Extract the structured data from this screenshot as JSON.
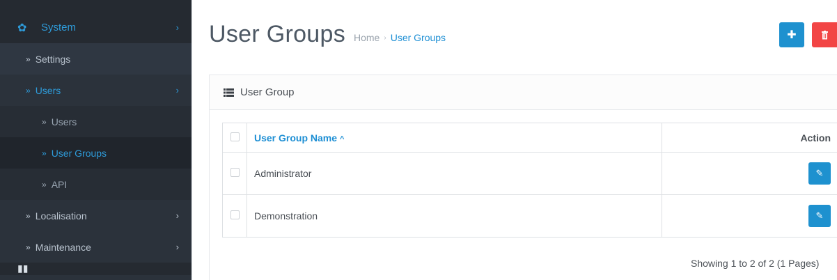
{
  "sidebar": {
    "system": "System",
    "settings": "Settings",
    "users_group": "Users",
    "users": "Users",
    "user_groups": "User Groups",
    "api": "API",
    "localisation": "Localisation",
    "maintenance": "Maintenance"
  },
  "header": {
    "title": "User Groups",
    "breadcrumb_home": "Home",
    "breadcrumb_current": "User Groups",
    "add_icon": "plus-icon",
    "delete_icon": "trash-icon"
  },
  "panel": {
    "title": "User Group",
    "columns": {
      "name": "User Group Name",
      "action": "Action"
    },
    "rows": [
      {
        "name": "Administrator"
      },
      {
        "name": "Demonstration"
      }
    ],
    "pagination": "Showing 1 to 2 of 2 (1 Pages)"
  },
  "colors": {
    "primary": "#1e91cf",
    "danger": "#f24545",
    "sidebar": "#2b323b"
  }
}
